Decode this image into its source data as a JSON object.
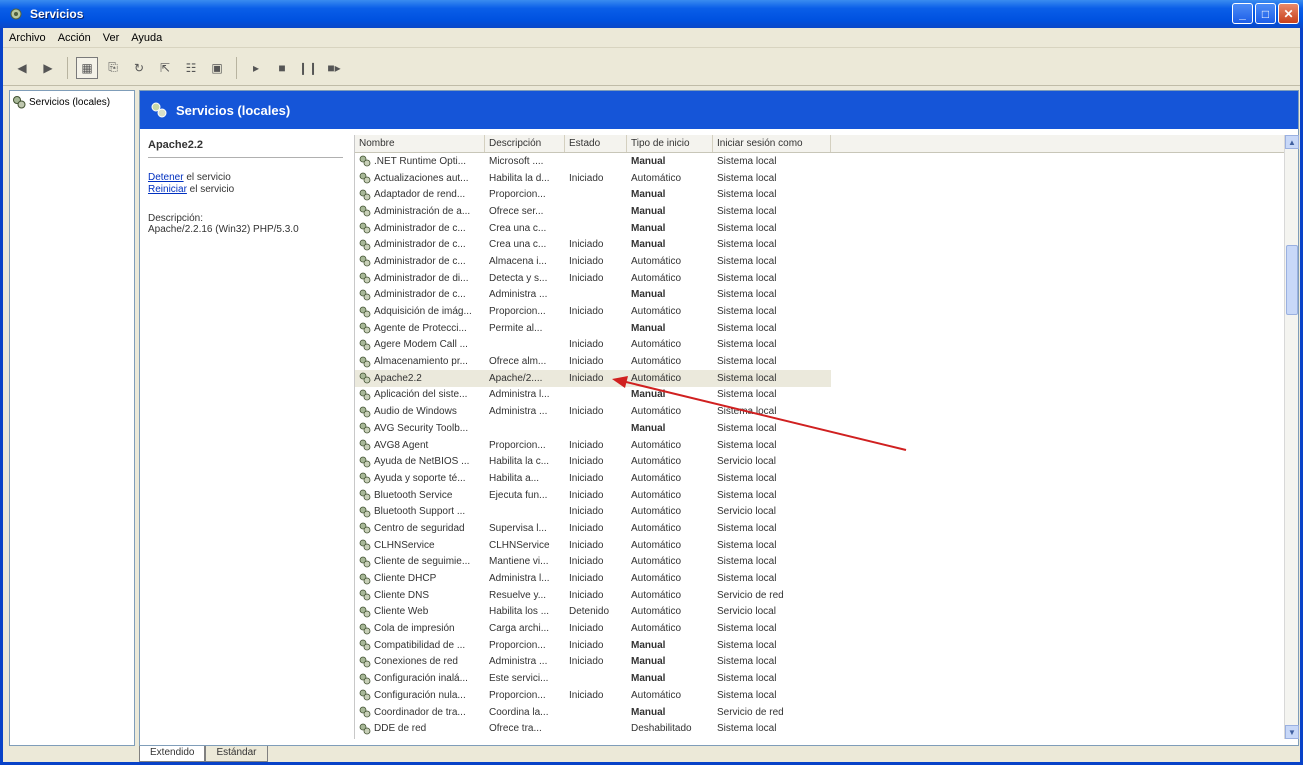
{
  "window": {
    "title": "Servicios"
  },
  "menu": [
    "Archivo",
    "Acción",
    "Ver",
    "Ayuda"
  ],
  "tree": {
    "root": "Servicios (locales)"
  },
  "header": {
    "title": "Servicios (locales)"
  },
  "details": {
    "service_name": "Apache2.2",
    "stop_link": "Detener",
    "stop_suffix": " el servicio",
    "restart_link": "Reiniciar",
    "restart_suffix": " el servicio",
    "description_label": "Descripción:",
    "description": "Apache/2.2.16 (Win32) PHP/5.3.0"
  },
  "columns": [
    "Nombre",
    "Descripción",
    "Estado",
    "Tipo de inicio",
    "Iniciar sesión como"
  ],
  "rows": [
    [
      ".NET Runtime Opti...",
      "Microsoft ....",
      "",
      "Manual",
      "Sistema local"
    ],
    [
      "Actualizaciones aut...",
      "Habilita la d...",
      "Iniciado",
      "Automático",
      "Sistema local"
    ],
    [
      "Adaptador de rend...",
      "Proporcion...",
      "",
      "Manual",
      "Sistema local"
    ],
    [
      "Administración de a...",
      "Ofrece ser...",
      "",
      "Manual",
      "Sistema local"
    ],
    [
      "Administrador de c...",
      "Crea una c...",
      "",
      "Manual",
      "Sistema local"
    ],
    [
      "Administrador de c...",
      "Crea una c...",
      "Iniciado",
      "Manual",
      "Sistema local"
    ],
    [
      "Administrador de c...",
      "Almacena i...",
      "Iniciado",
      "Automático",
      "Sistema local"
    ],
    [
      "Administrador de di...",
      "Detecta y s...",
      "Iniciado",
      "Automático",
      "Sistema local"
    ],
    [
      "Administrador de c...",
      "Administra ...",
      "",
      "Manual",
      "Sistema local"
    ],
    [
      "Adquisición de imág...",
      "Proporcion...",
      "Iniciado",
      "Automático",
      "Sistema local"
    ],
    [
      "Agente de Protecci...",
      "Permite al...",
      "",
      "Manual",
      "Sistema local"
    ],
    [
      "Agere Modem Call ...",
      "",
      "Iniciado",
      "Automático",
      "Sistema local"
    ],
    [
      "Almacenamiento pr...",
      "Ofrece alm...",
      "Iniciado",
      "Automático",
      "Sistema local"
    ],
    [
      "Apache2.2",
      "Apache/2....",
      "Iniciado",
      "Automático",
      "Sistema local"
    ],
    [
      "Aplicación del siste...",
      "Administra l...",
      "",
      "Manual",
      "Sistema local"
    ],
    [
      "Audio de Windows",
      "Administra ...",
      "Iniciado",
      "Automático",
      "Sistema local"
    ],
    [
      "AVG Security Toolb...",
      "",
      "",
      "Manual",
      "Sistema local"
    ],
    [
      "AVG8 Agent",
      "Proporcion...",
      "Iniciado",
      "Automático",
      "Sistema local"
    ],
    [
      "Ayuda de NetBIOS ...",
      "Habilita la c...",
      "Iniciado",
      "Automático",
      "Servicio local"
    ],
    [
      "Ayuda y soporte té...",
      "Habilita a...",
      "Iniciado",
      "Automático",
      "Sistema local"
    ],
    [
      "Bluetooth Service",
      "Ejecuta fun...",
      "Iniciado",
      "Automático",
      "Sistema local"
    ],
    [
      "Bluetooth Support ...",
      "",
      "Iniciado",
      "Automático",
      "Servicio local"
    ],
    [
      "Centro de seguridad",
      "Supervisa l...",
      "Iniciado",
      "Automático",
      "Sistema local"
    ],
    [
      "CLHNService",
      "CLHNService",
      "Iniciado",
      "Automático",
      "Sistema local"
    ],
    [
      "Cliente de seguimie...",
      "Mantiene vi...",
      "Iniciado",
      "Automático",
      "Sistema local"
    ],
    [
      "Cliente DHCP",
      "Administra l...",
      "Iniciado",
      "Automático",
      "Sistema local"
    ],
    [
      "Cliente DNS",
      "Resuelve y...",
      "Iniciado",
      "Automático",
      "Servicio de red"
    ],
    [
      "Cliente Web",
      "Habilita los ...",
      "Detenido",
      "Automático",
      "Servicio local"
    ],
    [
      "Cola de impresión",
      "Carga archi...",
      "Iniciado",
      "Automático",
      "Sistema local"
    ],
    [
      "Compatibilidad de ...",
      "Proporcion...",
      "Iniciado",
      "Manual",
      "Sistema local"
    ],
    [
      "Conexiones de red",
      "Administra ...",
      "Iniciado",
      "Manual",
      "Sistema local"
    ],
    [
      "Configuración inalá...",
      "Este servici...",
      "",
      "Manual",
      "Sistema local"
    ],
    [
      "Configuración nula...",
      "Proporcion...",
      "Iniciado",
      "Automático",
      "Sistema local"
    ],
    [
      "Coordinador de tra...",
      "Coordina la...",
      "",
      "Manual",
      "Servicio de red"
    ],
    [
      "DDE de red",
      "Ofrece tra...",
      "",
      "Deshabilitado",
      "Sistema local"
    ]
  ],
  "selected_row": 13,
  "tabs": [
    "Extendido",
    "Estándar"
  ],
  "colors": {
    "title_bar": "#0a5ee8",
    "header_band": "#1555d8",
    "annotation_arrow": "#d02020"
  }
}
